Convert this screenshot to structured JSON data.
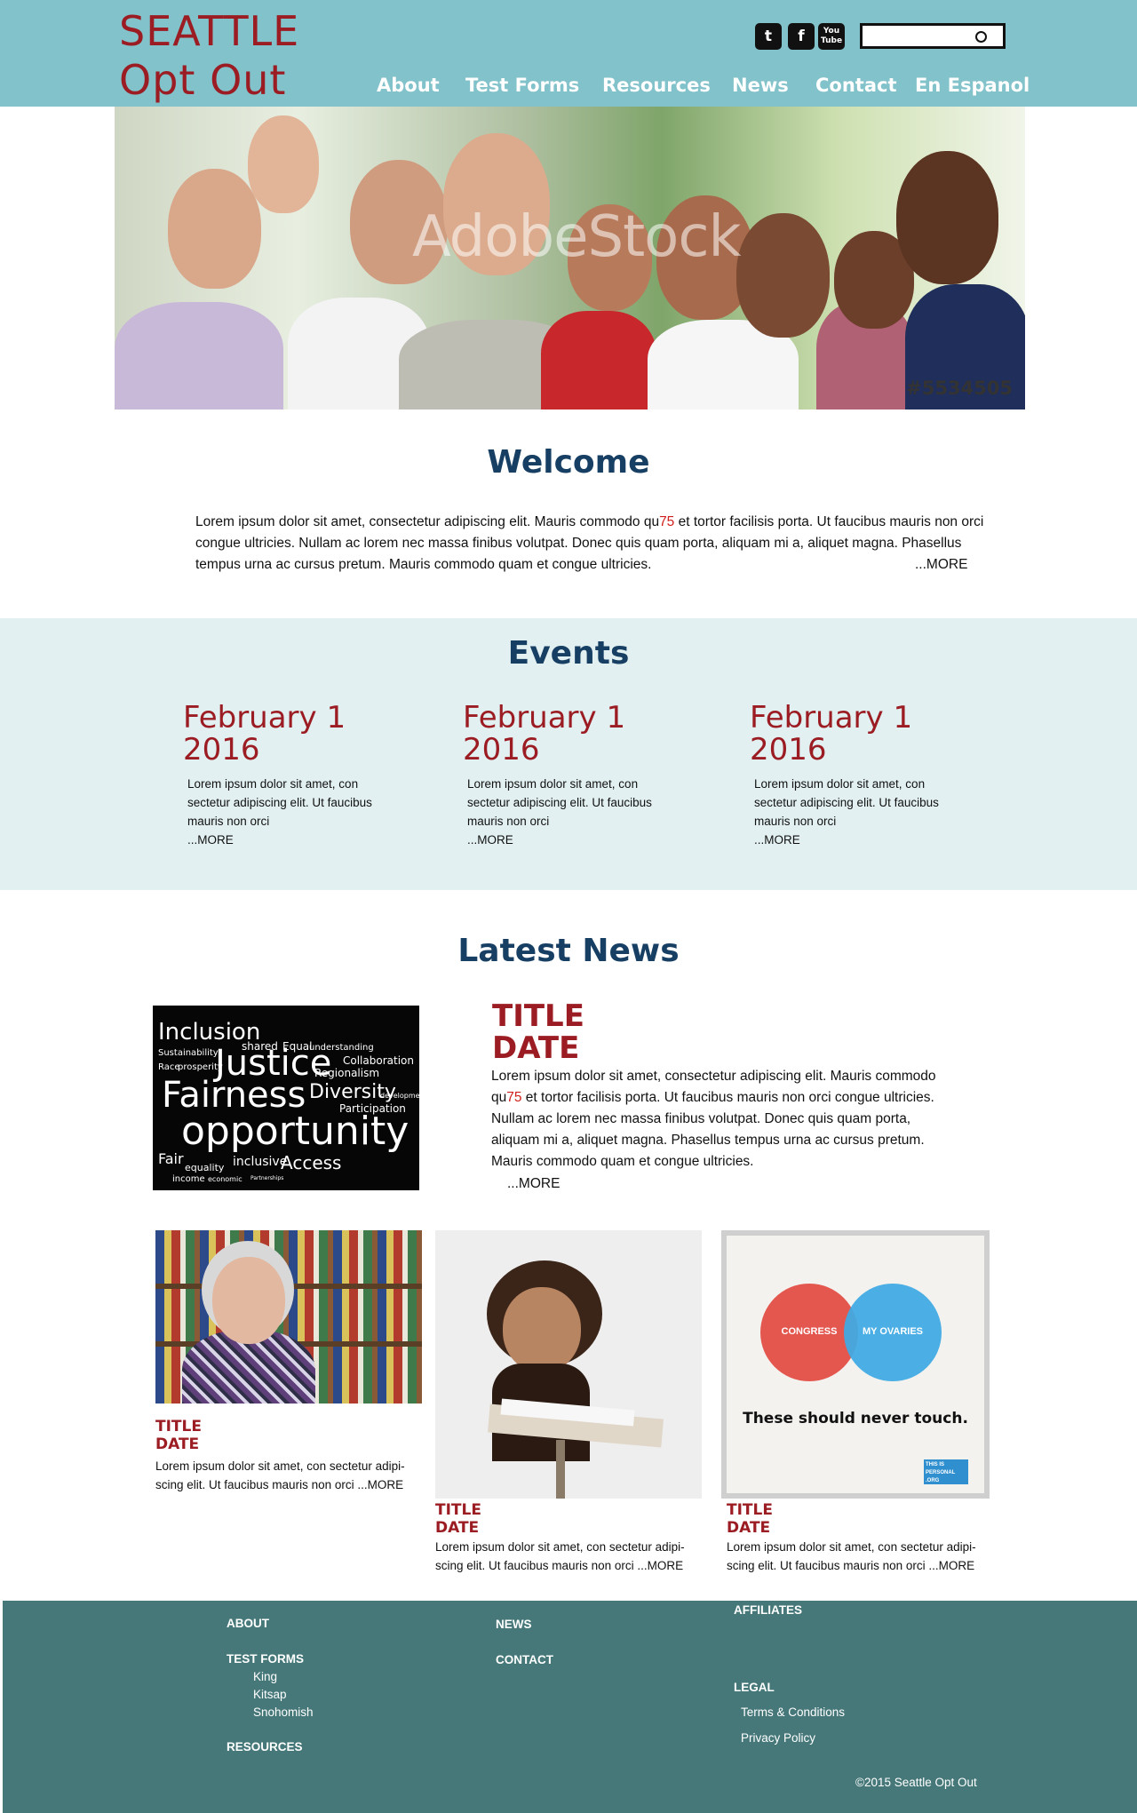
{
  "header": {
    "logo_line1": "SEATTLE",
    "logo_line2": "Opt Out",
    "social": {
      "twitter": "t",
      "facebook": "f",
      "youtube": "You Tube"
    },
    "search_placeholder": "",
    "nav": [
      "About",
      "Test Forms",
      "Resources",
      "News",
      "Contact",
      "En Espanol"
    ]
  },
  "hero": {
    "watermark": "AdobeStock",
    "stock_id": "#5534505"
  },
  "welcome": {
    "title": "Welcome",
    "text_a": "Lorem ipsum dolor sit amet, consectetur adipiscing elit. Mauris commodo qu",
    "text_num": "75",
    "text_b": " et tortor facilisis porta. Ut faucibus mauris non orci congue ultricies. Nullam ac lorem nec massa finibus volutpat. Donec quis quam porta, aliquam mi a, aliquet magna. Phasellus tempus urna ac cursus pretum. Mauris commodo quam et congue ultricies.",
    "more": "...MORE"
  },
  "events": {
    "title": "Events",
    "items": [
      {
        "date_line1": "February 1",
        "date_line2": "2016",
        "text": "Lorem ipsum dolor sit amet, con sectetur adipiscing elit. Ut faucibus mauris non orci",
        "more": "...MORE"
      },
      {
        "date_line1": "February 1",
        "date_line2": "2016",
        "text": "Lorem ipsum dolor sit amet, con sectetur adipiscing elit. Ut faucibus mauris non orci",
        "more": "...MORE"
      },
      {
        "date_line1": "February 1",
        "date_line2": "2016",
        "text": "Lorem ipsum dolor sit amet, con sectetur adipiscing elit. Ut faucibus mauris non orci",
        "more": "...MORE"
      }
    ]
  },
  "news": {
    "title": "Latest News",
    "featured": {
      "title": "TITLE",
      "date": "DATE",
      "text_a": "Lorem ipsum dolor sit amet, consectetur adipiscing elit. Mauris commodo qu",
      "text_num": "75",
      "text_b": " et tortor facilisis porta. Ut faucibus mauris non orci congue ultricies. Nullam ac lorem nec massa finibus volutpat. Donec quis quam porta, aliquam mi a, aliquet magna. Phasellus tempus urna ac cursus pretum. Mauris commodo quam et congue ultricies.",
      "more": "...MORE",
      "cloud_words": [
        "Inclusion",
        "shared",
        "Equal",
        "understanding",
        "Sustainability",
        "Justice",
        "Collaboration",
        "Race",
        "prosperity",
        "Regionalism",
        "Fairness",
        "Diversity",
        "Participation",
        "development",
        "opportunity",
        "Fair",
        "equality",
        "inclusive",
        "Access",
        "income",
        "economic",
        "Partnerships"
      ]
    },
    "items": [
      {
        "title": "TITLE",
        "date": "DATE",
        "text": "Lorem ipsum dolor sit amet, con sectetur adipi-scing elit. Ut faucibus mauris non orci ...MORE"
      },
      {
        "title": "TITLE",
        "date": "DATE",
        "text": "Lorem ipsum dolor sit amet, con sectetur adipi-scing elit. Ut faucibus mauris non orci ...MORE"
      },
      {
        "title": "TITLE",
        "date": "DATE",
        "text": "Lorem ipsum dolor sit amet, con sectetur adipi-scing elit. Ut faucibus mauris non orci ...MORE"
      }
    ],
    "poster": {
      "left": "CONGRESS",
      "right": "MY OVARIES",
      "caption": "These should never touch.",
      "badge": "THIS IS PERSONAL .ORG"
    }
  },
  "footer": {
    "about": "ABOUT",
    "test_forms": "TEST FORMS",
    "test_forms_items": [
      "King",
      "Kitsap",
      "Snohomish"
    ],
    "resources": "RESOURCES",
    "news": "NEWS",
    "contact": "CONTACT",
    "affiliates": "AFFILIATES",
    "legal": "LEGAL",
    "legal_items": [
      "Terms & Conditions",
      "Privacy Policy"
    ],
    "copyright": "©2015  Seattle Opt Out"
  },
  "colors": {
    "header_bg": "#82c2ca",
    "brand_red": "#9b1c22",
    "heading_blue": "#173f63",
    "events_bg": "#e2f0f1",
    "footer_bg": "#46787a"
  }
}
